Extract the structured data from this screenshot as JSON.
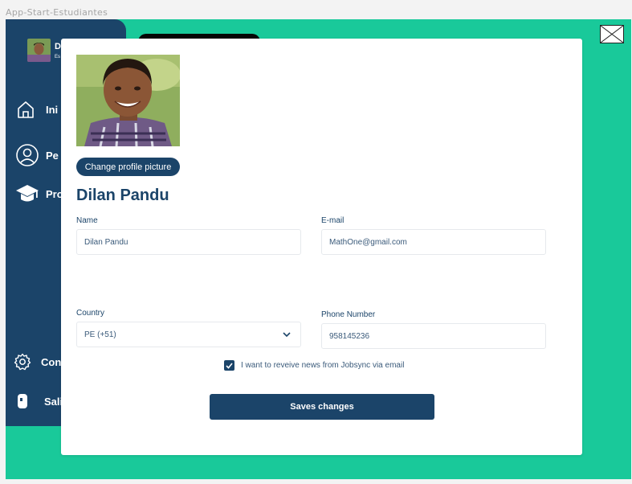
{
  "frame_label": "App-Start-Estudiantes",
  "sidebar": {
    "user_initial": "D",
    "user_subtitle": "Es",
    "items": [
      {
        "label": "Ini",
        "icon": "home-icon"
      },
      {
        "label": "Pe",
        "icon": "user-icon"
      },
      {
        "label": "Pro",
        "icon": "graduation-cap-icon"
      },
      {
        "label": "Con",
        "icon": "gear-icon"
      },
      {
        "label": "Sali",
        "icon": "logout-icon"
      }
    ]
  },
  "modal": {
    "change_picture_label": "Change profile picture",
    "profile_name": "Dilan Pandu",
    "fields": {
      "name": {
        "label": "Name",
        "value": "Dilan Pandu"
      },
      "email": {
        "label": "E-mail",
        "value": "MathOne@gmail.com"
      },
      "country": {
        "label": "Country",
        "value": "PE (+51)"
      },
      "phone": {
        "label": "Phone Number",
        "value": "958145236"
      }
    },
    "newsletter": {
      "label": "I want to reveive news from Jobsync via email",
      "checked": true
    },
    "save_label": "Saves changes"
  },
  "colors": {
    "background_green": "#19c99a",
    "navy": "#1b4469",
    "frame_bg": "#f3f3f3"
  }
}
